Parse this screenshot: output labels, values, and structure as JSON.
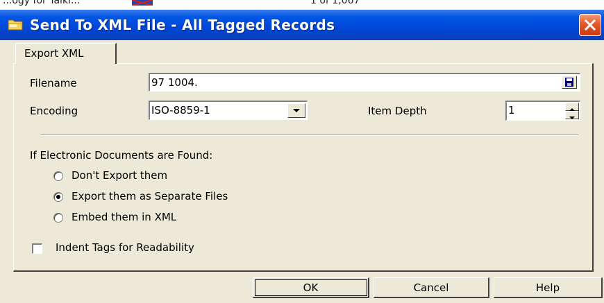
{
  "background_strip": {
    "left_text": "...ogy for Talki...",
    "right_text": "1 of 1,067"
  },
  "window": {
    "title": "Send To XML File - All Tagged Records",
    "title_bar_color": "#0054e3",
    "close_icon": "close-icon"
  },
  "tabs": [
    {
      "label": "Export XML",
      "selected": true
    }
  ],
  "filename": {
    "label": "Filename",
    "value": "97 1004.",
    "browse_icon": "save-disk-icon"
  },
  "encoding": {
    "label": "Encoding",
    "value": "ISO-8859-1"
  },
  "item_depth": {
    "label": "Item Depth",
    "value": "1"
  },
  "documents": {
    "heading": "If Electronic Documents are Found:",
    "options": [
      {
        "label": "Don't Export them",
        "selected": false
      },
      {
        "label": "Export them as Separate Files",
        "selected": true
      },
      {
        "label": "Embed them in XML",
        "selected": false
      }
    ]
  },
  "indent": {
    "label": "Indent Tags for Readability",
    "checked": false
  },
  "buttons": {
    "ok": "OK",
    "cancel": "Cancel",
    "help": "Help"
  }
}
